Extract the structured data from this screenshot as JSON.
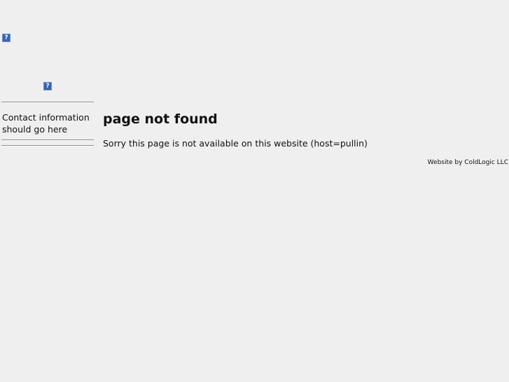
{
  "header": {
    "image_alt": "?"
  },
  "sidebar": {
    "image_alt": "?",
    "contact_text": "Contact information should go here"
  },
  "main": {
    "title": "page not found",
    "message": "Sorry this page is not available on this website (host=pullin)"
  },
  "footer": {
    "credit": "Website by ColdLogic LLC"
  }
}
